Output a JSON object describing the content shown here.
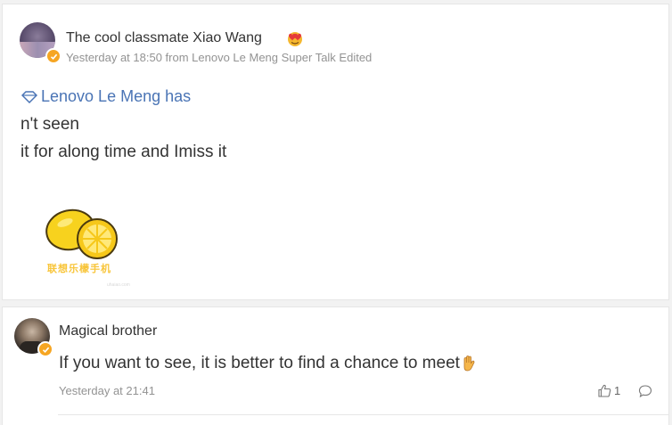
{
  "post": {
    "author": "The cool classmate Xiao Wang",
    "meta": "Yesterday at 18:50 from Lenovo Le Meng Super Talk Edited",
    "topic_link": "Lenovo Le Meng has",
    "body_lines": [
      "n't seen",
      "it for along time and Imiss it"
    ],
    "image": {
      "caption": "联想乐檬手机",
      "watermark": "uhaiao.com"
    },
    "icons": {
      "avatar": "user-avatar",
      "verified": "verified-badge-icon",
      "emoji": "heart-eyes-emoji-icon",
      "topic": "diamond-topic-icon"
    }
  },
  "comment": {
    "author": "Magical brother",
    "text": "If you want to see, it is better to find a chance to meet",
    "time": "Yesterday at 21:41",
    "like_count": "1",
    "icons": {
      "wave": "waving-hand-emoji-icon",
      "like": "thumbs-up-icon",
      "reply": "comment-bubble-icon"
    }
  },
  "colors": {
    "link": "#4a74b5",
    "text": "#333333",
    "muted": "#939393",
    "badge": "#f6a623",
    "lemon": "#f8c53a"
  }
}
